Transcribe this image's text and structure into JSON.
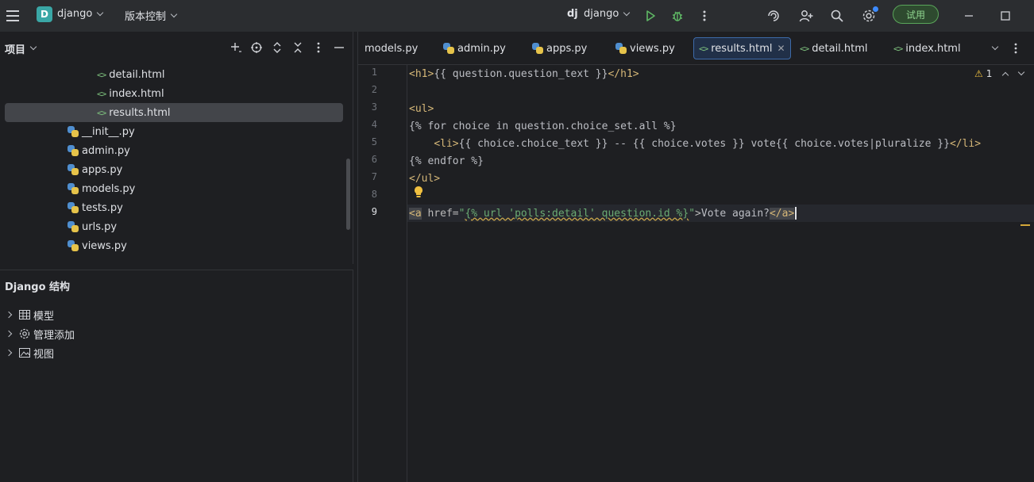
{
  "titlebar": {
    "project_initial": "D",
    "project_name": "django",
    "vcs_label": "版本控制",
    "run_config_icon": "dj",
    "run_config": "django",
    "trial_label": "试用",
    "icons": [
      "menu-icon",
      "run-icon",
      "debug-icon",
      "more-icon",
      "ai-assistant-icon",
      "add-user-icon",
      "search-icon",
      "settings-icon",
      "minimize-icon",
      "maximize-icon"
    ]
  },
  "project_panel": {
    "title": "项目",
    "tree": [
      {
        "label": "detail.html",
        "type": "html"
      },
      {
        "label": "index.html",
        "type": "html"
      },
      {
        "label": "results.html",
        "type": "html",
        "selected": true
      },
      {
        "label": "__init__.py",
        "type": "py"
      },
      {
        "label": "admin.py",
        "type": "py"
      },
      {
        "label": "apps.py",
        "type": "py"
      },
      {
        "label": "models.py",
        "type": "py"
      },
      {
        "label": "tests.py",
        "type": "py"
      },
      {
        "label": "urls.py",
        "type": "py"
      },
      {
        "label": "views.py",
        "type": "py"
      }
    ]
  },
  "structure_panel": {
    "title": "Django 结构",
    "items": [
      {
        "label": "模型",
        "icon": "table-icon"
      },
      {
        "label": "管理添加",
        "icon": "gear-icon"
      },
      {
        "label": "视图",
        "icon": "image-icon"
      }
    ]
  },
  "editor": {
    "tabs": [
      {
        "label": "models.py",
        "type": "py"
      },
      {
        "label": "admin.py",
        "type": "py"
      },
      {
        "label": "apps.py",
        "type": "py"
      },
      {
        "label": "views.py",
        "type": "py"
      },
      {
        "label": "results.html",
        "type": "html",
        "active": true
      },
      {
        "label": "detail.html",
        "type": "html"
      },
      {
        "label": "index.html",
        "type": "html"
      }
    ],
    "line_numbers": [
      "1",
      "2",
      "3",
      "4",
      "5",
      "6",
      "7",
      "8",
      "9"
    ],
    "current_line": "9",
    "warning_count": "1",
    "code": {
      "l1_open": "<h1>",
      "l1_expr": "{{ question.question_text }}",
      "l1_close": "</h1>",
      "l3": "<ul>",
      "l4": "{% for choice in question.choice_set.all %}",
      "l5_indent": "    ",
      "l5_open": "<li>",
      "l5_expr": "{{ choice.choice_text }} -- {{ choice.votes }} vote{{ choice.votes|pluralize }}",
      "l5_close": "</li>",
      "l6": "{% endfor %}",
      "l7": "</ul>",
      "l9_open": "<a",
      "l9_attr": " href=",
      "l9_q1": "\"",
      "l9_tpl": "{% url 'polls:detail' question.id %}",
      "l9_q2": "\"",
      "l9_gt": ">",
      "l9_text": "Vote again?",
      "l9_close": "</a>"
    }
  }
}
